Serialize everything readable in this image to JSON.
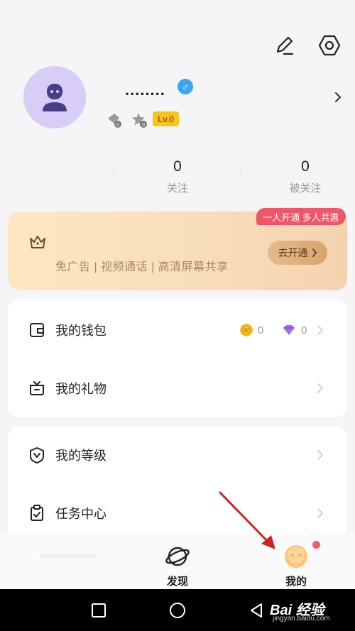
{
  "profile": {
    "nickname": "........",
    "gender_symbol": "♂",
    "level": "Lv.0"
  },
  "stats": {
    "following": {
      "value": "0",
      "label": "关注"
    },
    "followers": {
      "value": "0",
      "label": "被关注"
    }
  },
  "vip": {
    "tag": "一人开通 多人共惠",
    "description": "免广告 | 视频通话 | 高清屏幕共享",
    "button_label": "去开通",
    "colors": {
      "tag": "#f0566a",
      "button": "#e3bb8b"
    }
  },
  "menu": {
    "wallet": {
      "label": "我的钱包",
      "coins": "0",
      "diamonds": "0"
    },
    "gift": {
      "label": "我的礼物"
    },
    "level": {
      "label": "我的等级"
    },
    "tasks": {
      "label": "任务中心"
    }
  },
  "tabs": {
    "discover": {
      "label": "发现"
    },
    "mine": {
      "label": "我的"
    }
  },
  "watermark": {
    "main": "Bai 经验",
    "sub": "jingyan.baidu.com"
  },
  "icons": [
    "edit-icon",
    "settings-icon",
    "avatar-person-icon",
    "male-icon",
    "medal-icon",
    "crown-icon",
    "wallet-icon",
    "coin-icon",
    "diamond-icon",
    "gift-icon",
    "level-shield-icon",
    "task-clipboard-icon",
    "planet-icon",
    "face-icon",
    "chevron-right-icon"
  ]
}
